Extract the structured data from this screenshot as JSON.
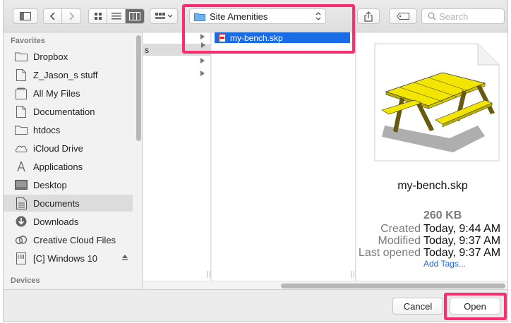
{
  "toolbar": {
    "path_popup_label": "Site Amenities",
    "search_placeholder": "Search"
  },
  "sidebar": {
    "favorites_heading": "Favorites",
    "devices_heading": "Devices",
    "items": [
      {
        "label": "Dropbox",
        "icon": "folder-icon"
      },
      {
        "label": "Z_Jason_s stuff",
        "icon": "document-icon"
      },
      {
        "label": "All My Files",
        "icon": "all-files-icon"
      },
      {
        "label": "Documentation",
        "icon": "document-icon"
      },
      {
        "label": "htdocs",
        "icon": "folder-icon"
      },
      {
        "label": "iCloud Drive",
        "icon": "cloud-icon"
      },
      {
        "label": "Applications",
        "icon": "applications-icon"
      },
      {
        "label": "Desktop",
        "icon": "desktop-icon"
      },
      {
        "label": "Documents",
        "icon": "documents-icon"
      },
      {
        "label": "Downloads",
        "icon": "downloads-icon"
      },
      {
        "label": "Creative Cloud Files",
        "icon": "creative-cloud-icon"
      },
      {
        "label": "[C] Windows 10",
        "icon": "drive-icon"
      }
    ]
  },
  "columns": {
    "col1_partial_text": "s"
  },
  "file": {
    "name": "my-bench.skp"
  },
  "preview": {
    "name": "my-bench.skp",
    "size": "260 KB",
    "created_label": "Created",
    "created_value": "Today, 9:44 AM",
    "modified_label": "Modified",
    "modified_value": "Today, 9:37 AM",
    "last_opened_label": "Last opened",
    "last_opened_value": "Today, 9:37 AM",
    "add_tags": "Add Tags..."
  },
  "buttons": {
    "cancel": "Cancel",
    "open": "Open"
  },
  "colors": {
    "selection_blue": "#1a6be6",
    "highlight_pink": "#ff2d6f"
  }
}
